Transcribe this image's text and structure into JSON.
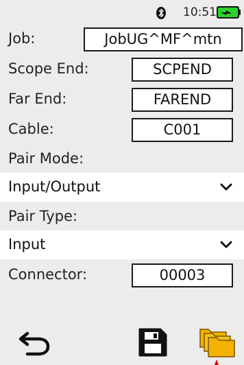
{
  "status": {
    "time": "10:51",
    "bluetooth_icon": "bluetooth-icon",
    "battery_icon": "battery-charging-icon",
    "battery_color": "#2bd12b"
  },
  "form": {
    "job": {
      "label": "Job:",
      "value": "JobUG^MF^mtn"
    },
    "scope_end": {
      "label": "Scope End:",
      "value": "SCPEND"
    },
    "far_end": {
      "label": "Far End:",
      "value": "FAREND"
    },
    "cable": {
      "label": "Cable:",
      "value": "C001"
    },
    "pair_mode": {
      "label": "Pair Mode:",
      "value": "Input/Output"
    },
    "pair_type": {
      "label": "Pair Type:",
      "value": "Input"
    },
    "connector": {
      "label": "Connector:",
      "value": "00003"
    }
  },
  "toolbar": {
    "back_icon": "back-arrow-icon",
    "save_icon": "floppy-disk-icon",
    "folder_icon": "folder-stack-icon",
    "folder_color": "#f3b200"
  }
}
